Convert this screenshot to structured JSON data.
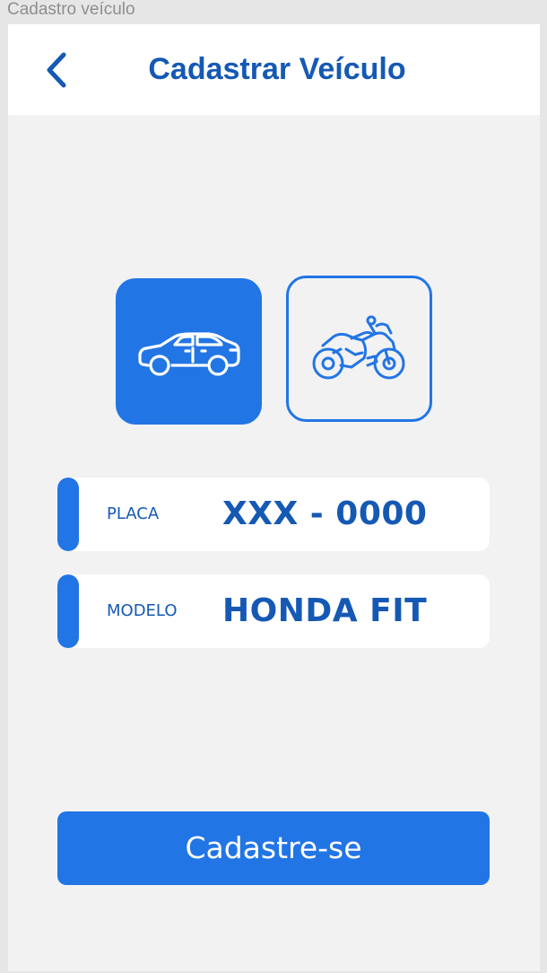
{
  "frame_label": "Cadastro veículo",
  "header": {
    "title": "Cadastrar Veículo",
    "back_icon": "chevron-left-icon"
  },
  "vehicle_types": [
    {
      "name": "car",
      "icon": "car-icon",
      "selected": true
    },
    {
      "name": "motorcycle",
      "icon": "motorcycle-icon",
      "selected": false
    }
  ],
  "form": {
    "placa": {
      "label": "PLACA",
      "value": "XXX - 0000"
    },
    "modelo": {
      "label": "MODELO",
      "value": "HONDA FIT"
    }
  },
  "submit_label": "Cadastre-se",
  "colors": {
    "primary": "#2275e5",
    "title": "#1559b4",
    "background": "#f2f2f2",
    "card": "#ffffff"
  }
}
